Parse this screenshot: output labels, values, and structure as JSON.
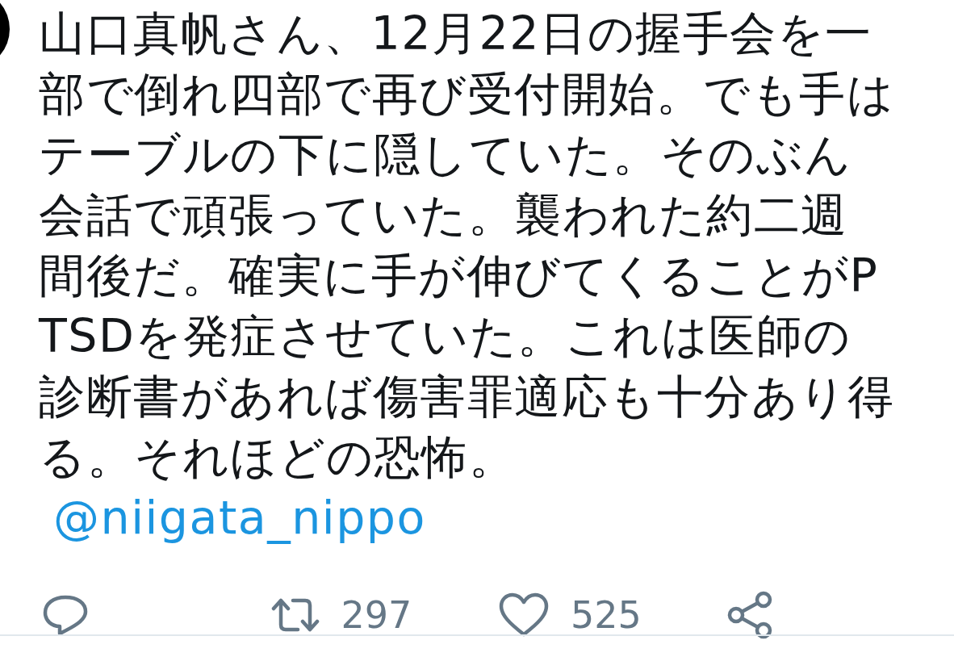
{
  "tweet": {
    "text": "山口真帆さん、12月22日の握手会を一部で倒れ四部で再び受付開始。でも手はテーブルの下に隠していた。そのぶん会話で頑張っていた。襲われた約二週間後だ。確実に手が伸びてくることがPTSDを発症させていた。これは医師の診断書があれば傷害罪適応も十分あり得る。それほどの恐怖。",
    "mention": "@niigata_nippo"
  },
  "actions": [
    {
      "kind": "reply"
    },
    {
      "kind": "retweet",
      "count": "297"
    },
    {
      "kind": "like",
      "count": "525"
    },
    {
      "kind": "share"
    }
  ]
}
